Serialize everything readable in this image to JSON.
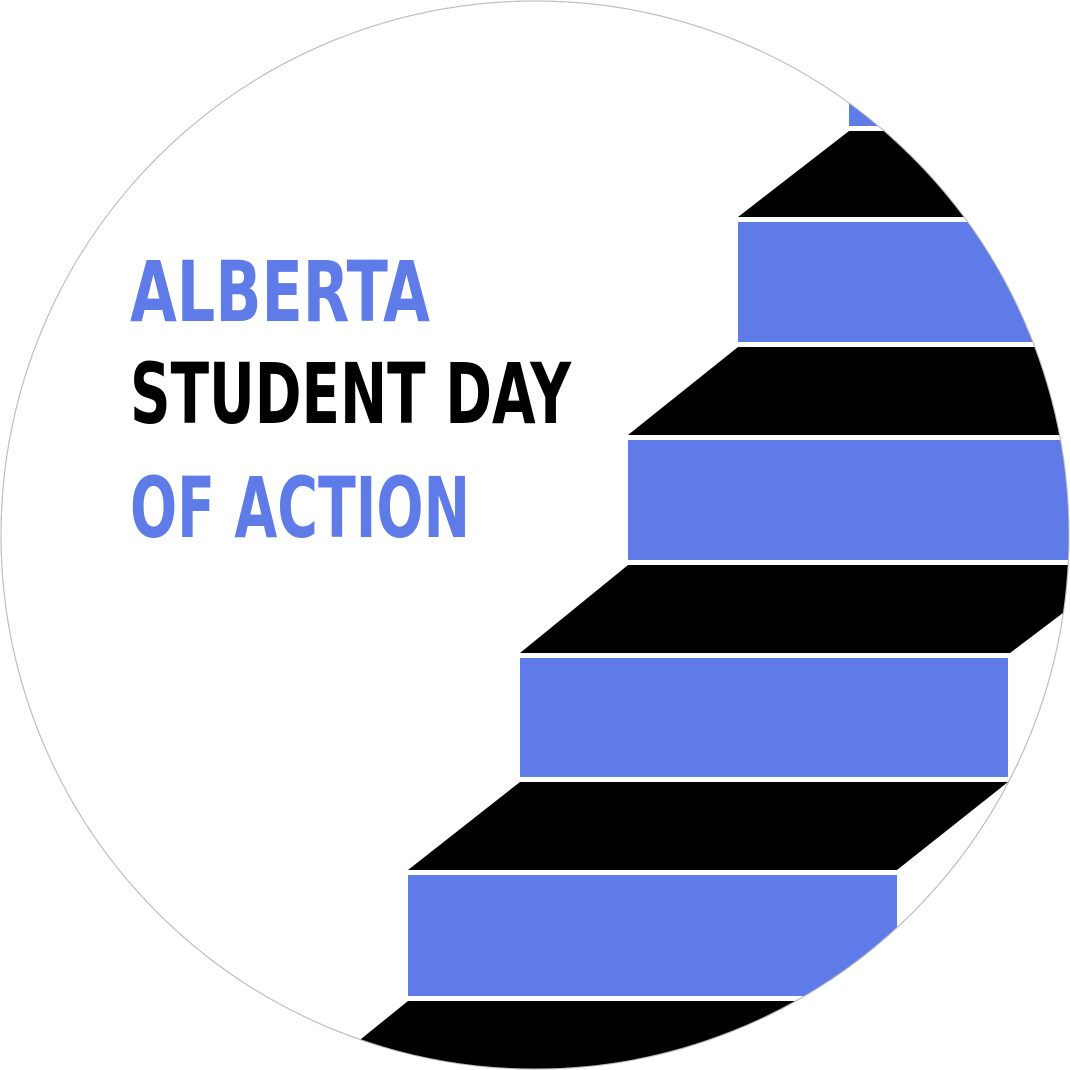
{
  "logo": {
    "title_line1": "ALBERTA",
    "title_line2": "STUDENT DAY",
    "title_line3": "OF ACTION",
    "colors": {
      "accent_blue": "#5e7be8",
      "stair_black": "#000000",
      "background": "#ffffff",
      "outline": "#bdbdbd"
    }
  }
}
